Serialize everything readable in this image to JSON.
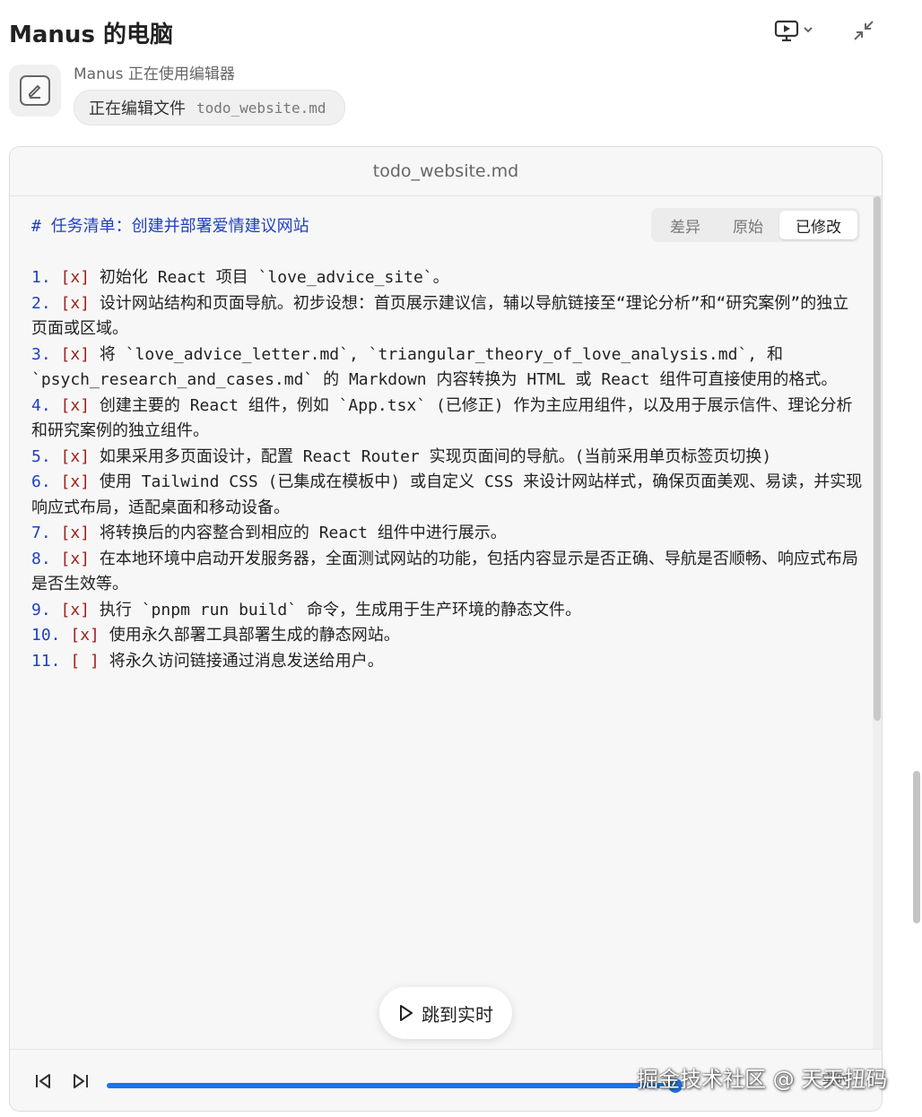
{
  "window": {
    "title": "Manus 的电脑"
  },
  "status": {
    "label": "Manus 正在使用编辑器",
    "action": "正在编辑文件",
    "file": "todo_website.md",
    "icon": "edit-icon"
  },
  "panel": {
    "title": "todo_website.md",
    "tabs": [
      {
        "label": "差异"
      },
      {
        "label": "原始"
      },
      {
        "label": "已修改"
      }
    ],
    "active_tab": "已修改"
  },
  "document": {
    "heading": "# 任务清单：创建并部署爱情建议网站",
    "items": [
      {
        "num": "1.",
        "check": "[x]",
        "text": " 初始化 React 项目 `love_advice_site`。"
      },
      {
        "num": "2.",
        "check": "[x]",
        "text": " 设计网站结构和页面导航。初步设想：首页展示建议信，辅以导航链接至“理论分析”和“研究案例”的独立页面或区域。"
      },
      {
        "num": "3.",
        "check": "[x]",
        "text": " 将 `love_advice_letter.md`, `triangular_theory_of_love_analysis.md`, 和 `psych_research_and_cases.md` 的 Markdown 内容转换为 HTML 或 React 组件可直接使用的格式。"
      },
      {
        "num": "4.",
        "check": "[x]",
        "text": " 创建主要的 React 组件，例如 `App.tsx` (已修正) 作为主应用组件，以及用于展示信件、理论分析和研究案例的独立组件。"
      },
      {
        "num": "5.",
        "check": "[x]",
        "text": " 如果采用多页面设计，配置 React Router 实现页面间的导航。(当前采用单页标签页切换)"
      },
      {
        "num": "6.",
        "check": "[x]",
        "text": " 使用 Tailwind CSS (已集成在模板中) 或自定义 CSS 来设计网站样式，确保页面美观、易读，并实现响应式布局，适配桌面和移动设备。"
      },
      {
        "num": "7.",
        "check": "[x]",
        "text": " 将转换后的内容整合到相应的 React 组件中进行展示。"
      },
      {
        "num": "8.",
        "check": "[x]",
        "text": " 在本地环境中启动开发服务器，全面测试网站的功能，包括内容显示是否正确、导航是否顺畅、响应式布局是否生效等。"
      },
      {
        "num": "9.",
        "check": "[x]",
        "text": " 执行 `pnpm run build` 命令，生成用于生产环境的静态文件。"
      },
      {
        "num": "10.",
        "check": "[x]",
        "text": " 使用永久部署工具部署生成的静态网站。"
      },
      {
        "num": "11.",
        "check": "[ ]",
        "text": " 将永久访问链接通过消息发送给用户。"
      }
    ]
  },
  "player": {
    "jump_label": "跳到实时",
    "live_label": "实时",
    "progress": 0.99
  },
  "watermark": "掘金技术社区 @ 天天扭码"
}
